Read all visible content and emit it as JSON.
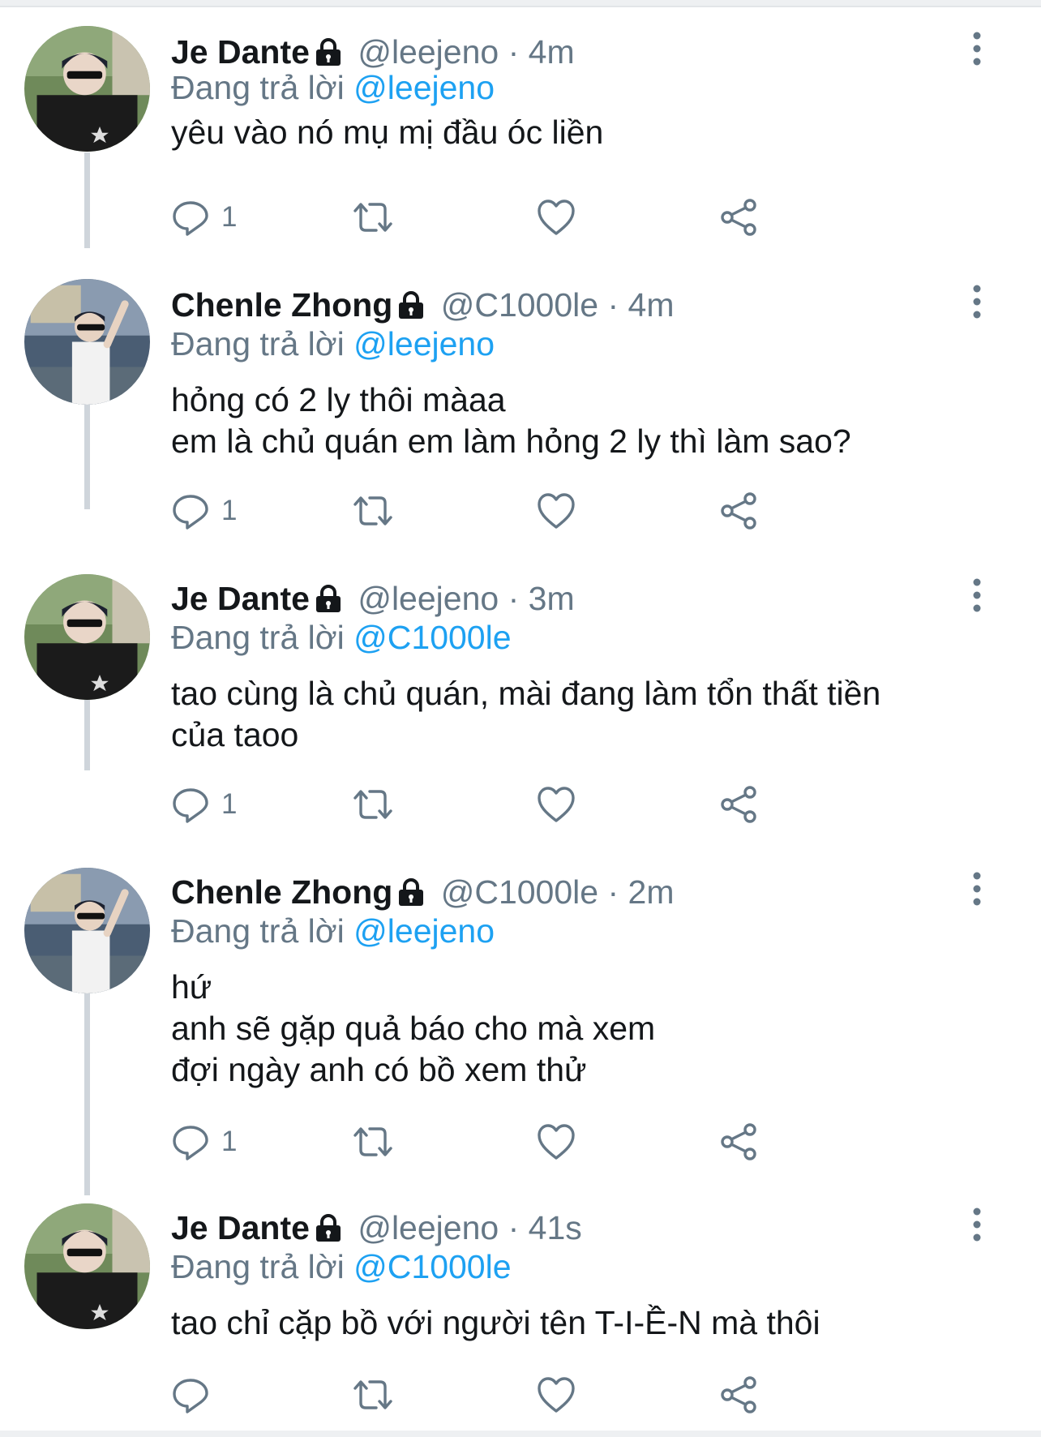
{
  "tweets": [
    {
      "name": "Je Dante",
      "handle": "@leejeno",
      "dot": "·",
      "time": "4m",
      "reply_prefix": "Đang trả lời",
      "reply_to": "@leejeno",
      "lines": [
        "yêu vào nó mụ mị đầu óc liền"
      ],
      "reply_count": "1",
      "avatar": "boy-black-shirt"
    },
    {
      "name": "Chenle Zhong",
      "handle": "@C1000le",
      "dot": "·",
      "time": "4m",
      "reply_prefix": "Đang trả lời",
      "reply_to": "@leejeno",
      "lines": [
        "hỏng có 2 ly thôi màaa",
        "em là chủ quán em làm hỏng 2 ly thì làm sao?"
      ],
      "reply_count": "1",
      "avatar": "boy-white-shirt"
    },
    {
      "name": "Je Dante",
      "handle": "@leejeno",
      "dot": "·",
      "time": "3m",
      "reply_prefix": "Đang trả lời",
      "reply_to": "@C1000le",
      "lines": [
        "tao cùng là chủ quán, mài đang làm tổn thất tiền",
        "của taoo"
      ],
      "reply_count": "1",
      "avatar": "boy-black-shirt"
    },
    {
      "name": "Chenle Zhong",
      "handle": "@C1000le",
      "dot": "·",
      "time": "2m",
      "reply_prefix": "Đang trả lời",
      "reply_to": "@leejeno",
      "lines": [
        "hứ",
        "anh sẽ gặp quả báo cho mà xem",
        "đợi ngày anh có bồ xem thử"
      ],
      "reply_count": "1",
      "avatar": "boy-white-shirt"
    },
    {
      "name": "Je Dante",
      "handle": "@leejeno",
      "dot": "·",
      "time": "41s",
      "reply_prefix": "Đang trả lời",
      "reply_to": "@C1000le",
      "lines": [
        "tao chỉ cặp bồ với người tên T-I-Ề-N mà thôi"
      ],
      "reply_count": "",
      "avatar": "boy-black-shirt"
    }
  ],
  "icons": {
    "reply": "reply-icon",
    "retweet": "retweet-icon",
    "like": "heart-icon",
    "share": "share-icon",
    "more": "more-vertical-icon",
    "protected": "lock-icon"
  },
  "colors": {
    "link": "#1da1f2",
    "secondary": "#657786",
    "text": "#14171a",
    "connector": "#cfd5db"
  }
}
